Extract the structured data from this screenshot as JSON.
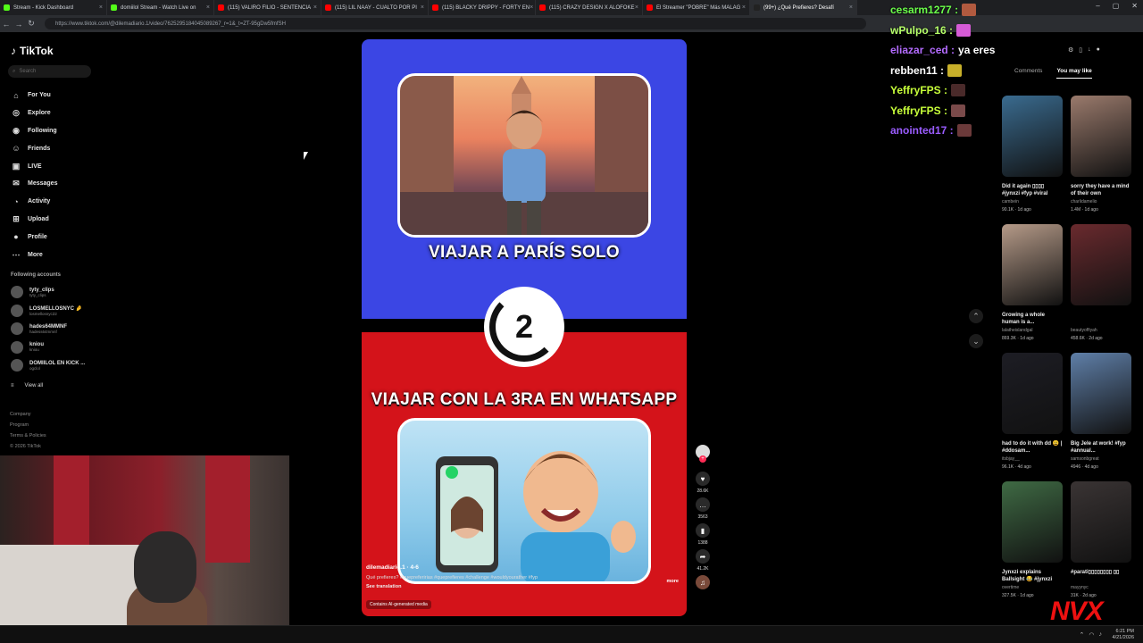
{
  "browser": {
    "tabs": [
      {
        "title": "Stream - Kick Dashboard",
        "color": "#53fc18"
      },
      {
        "title": "domiilol Stream - Watch Live on",
        "color": "#53fc18"
      },
      {
        "title": "(115) VALIRO FILIO - SENTENCIA",
        "color": "#ff0000"
      },
      {
        "title": "(115) LIL NAAY - CUALTO POR PI",
        "color": "#ff0000"
      },
      {
        "title": "(115) BLACKY DRIPPY - FORTY EN",
        "color": "#ff0000"
      },
      {
        "title": "(115) CRAZY DESIGN X ALOFOKE",
        "color": "#ff0000"
      },
      {
        "title": "El Streamer \"POBRE\" Más MALAG",
        "color": "#ff0000"
      },
      {
        "title": "(99+) ¿Qué Prefieres? Desafí",
        "color": "#222222"
      }
    ],
    "url": "https://www.tiktok.com/@dilemadiario.1/video/7625295184045089267_r=1&_t=ZT-95gDw5fmfSH"
  },
  "tiktok": {
    "logo": "TikTok",
    "search_placeholder": "Search",
    "nav": [
      {
        "label": "For You",
        "icon": "home-icon"
      },
      {
        "label": "Explore",
        "icon": "compass-icon"
      },
      {
        "label": "Following",
        "icon": "following-icon"
      },
      {
        "label": "Friends",
        "icon": "friends-icon"
      },
      {
        "label": "LIVE",
        "icon": "live-icon"
      },
      {
        "label": "Messages",
        "icon": "messages-icon"
      },
      {
        "label": "Activity",
        "icon": "activity-icon"
      },
      {
        "label": "Upload",
        "icon": "upload-icon"
      },
      {
        "label": "Profile",
        "icon": "profile-icon"
      },
      {
        "label": "More",
        "icon": "more-icon"
      }
    ],
    "following_title": "Following accounts",
    "accounts": [
      {
        "name": "tyty_clips",
        "handle": "tyty_clips"
      },
      {
        "name": "LOSMELLOSNYC 🤌",
        "handle": "losmellosnyc22"
      },
      {
        "name": "hades64MMNF",
        "handle": "hadess64mmnf"
      },
      {
        "name": "kniou",
        "handle": "kniou"
      },
      {
        "name": "DOMIILOL EN KICK ...",
        "handle": "ogclol"
      }
    ],
    "view_all": "View all",
    "footer": [
      "Company",
      "Program",
      "Terms & Policies",
      "© 2026 TikTok"
    ],
    "video": {
      "headline_top": "VIAJAR A PARÍS SOLO",
      "countdown": "2",
      "headline_bottom": "VIAJAR CON LA 3RA EN WHATSAPP",
      "username": "dilemadiario.1 · 4-6",
      "description": "Qué prefieres? #quepreferirias #queprefieres #challenge #wouldyourather #fyp",
      "more": "more",
      "translation": "See translation",
      "ai_badge": "Contains AI-generated media",
      "colors": {
        "top": "#3b46e4",
        "bottom": "#d4131a"
      }
    },
    "actions": [
      {
        "icon": "heart-icon",
        "count": "28.6K"
      },
      {
        "icon": "comment-icon",
        "count": "3563"
      },
      {
        "icon": "bookmark-icon",
        "count": "1388"
      },
      {
        "icon": "share-icon",
        "count": "41.2K"
      }
    ],
    "right_panel": {
      "tabs": [
        "Comments",
        "You may like"
      ],
      "cards": [
        {
          "title": "Did it again ▯▯▯▯ #jynxzi #fyp #viral",
          "author": "cambein",
          "meta": "90.1K · 1d ago",
          "color": "#3a6b8f"
        },
        {
          "title": "sorry they have a mind of their own",
          "author": "charlidamelio",
          "meta": "1.4M · 1d ago",
          "color": "#9a7a6c"
        },
        {
          "title": "Growing a whole human is a...",
          "author": "lalatheislandgal",
          "meta": "869.3K · 1d ago",
          "color": "#b59a88"
        },
        {
          "title": "",
          "author": "beautyoffiyah",
          "meta": "458.6K · 2d ago",
          "color": "#6a2a2e"
        },
        {
          "title": "had to do it with dd 😩 | #ddosam...",
          "author": "itsbjay__",
          "meta": "96.1K · 4d ago",
          "color": "#1d1d24"
        },
        {
          "title": "Big Jele at work! #fyp #annual...",
          "author": "samsonbgreat",
          "meta": "4946 · 4d ago",
          "color": "#5f7fa8"
        },
        {
          "title": "Jynxzi explains Ballsight 😂 #jynxzi",
          "author": "overtime",
          "meta": "327.5K · 1d ago",
          "color": "#3f6a44"
        },
        {
          "title": "#parati▯▯▯▯▯▯▯▯ ▯▯",
          "author": "mayynyc",
          "meta": "31K · 2d ago",
          "color": "#3a3434"
        }
      ]
    }
  },
  "chat": [
    {
      "user": "cesarm1277 :",
      "text": "",
      "color": "#6bff4a"
    },
    {
      "user": "wPulpo_16 :",
      "text": "",
      "color": "#b6ff6a"
    },
    {
      "user": "eliazar_ced :",
      "text": "ya eres",
      "color": "#b46cff"
    },
    {
      "user": "rebben11 :",
      "text": "",
      "color": "#ffffff"
    },
    {
      "user": "YeffryFPS :",
      "text": "",
      "color": "#c8ff3a"
    },
    {
      "user": "YeffryFPS :",
      "text": "",
      "color": "#c8ff3a"
    },
    {
      "user": "anointed17 :",
      "text": "",
      "color": "#9a5cff"
    }
  ],
  "overlay_logo": "NVX",
  "taskbar": {
    "time": "6:21 PM",
    "date": "4/21/2026"
  }
}
